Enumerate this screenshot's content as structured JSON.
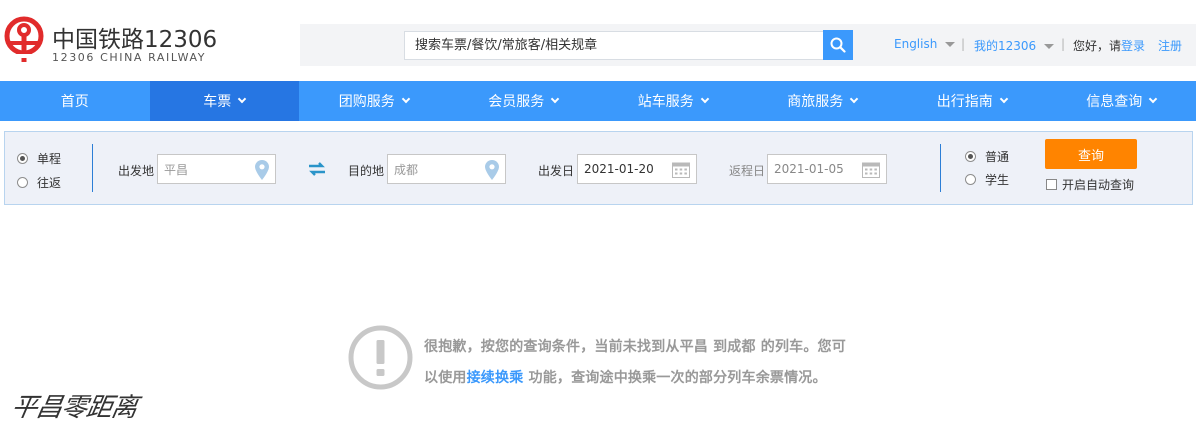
{
  "header": {
    "brand_cn": "中国铁路12306",
    "brand_en": "12306 CHINA RAILWAY",
    "search_placeholder": "搜索车票/餐饮/常旅客/相关规章",
    "links": {
      "english": "English",
      "sep1": "|",
      "my12306": "我的12306",
      "sep2": "|",
      "greeting": "您好，请",
      "login": "登录",
      "register": "注册"
    }
  },
  "nav": {
    "items": [
      {
        "label": "首页",
        "has_menu": false,
        "active": false
      },
      {
        "label": "车票",
        "has_menu": true,
        "active": true
      },
      {
        "label": "团购服务",
        "has_menu": true,
        "active": false
      },
      {
        "label": "会员服务",
        "has_menu": true,
        "active": false
      },
      {
        "label": "站车服务",
        "has_menu": true,
        "active": false
      },
      {
        "label": "商旅服务",
        "has_menu": true,
        "active": false
      },
      {
        "label": "出行指南",
        "has_menu": true,
        "active": false
      },
      {
        "label": "信息查询",
        "has_menu": true,
        "active": false
      }
    ]
  },
  "query": {
    "trip_types": [
      {
        "label": "单程",
        "selected": true
      },
      {
        "label": "往返",
        "selected": false
      }
    ],
    "from_label": "出发地",
    "from_value": "平昌",
    "to_label": "目的地",
    "to_value": "成都",
    "depart_label": "出发日",
    "depart_value": "2021-01-20",
    "return_label": "返程日",
    "return_value": "2021-01-05",
    "passenger_types": [
      {
        "label": "普通",
        "selected": true
      },
      {
        "label": "学生",
        "selected": false
      }
    ],
    "query_button": "查询",
    "auto_query_label": "开启自动查询"
  },
  "result": {
    "message_part1": "很抱歉，按您的查询条件，当前未找到从平昌 到成都 的列车。您可以使用",
    "transfer_link": "接续换乘",
    "message_part2": " 功能，查询途中换乘一次的部分列车余票情况。"
  },
  "watermark": "平昌零距离",
  "colors": {
    "brand_red": "#e12b2b",
    "nav_blue": "#3b99fc",
    "nav_active": "#2676e3",
    "query_orange": "#ff8400",
    "link_blue": "#3b99fc"
  }
}
